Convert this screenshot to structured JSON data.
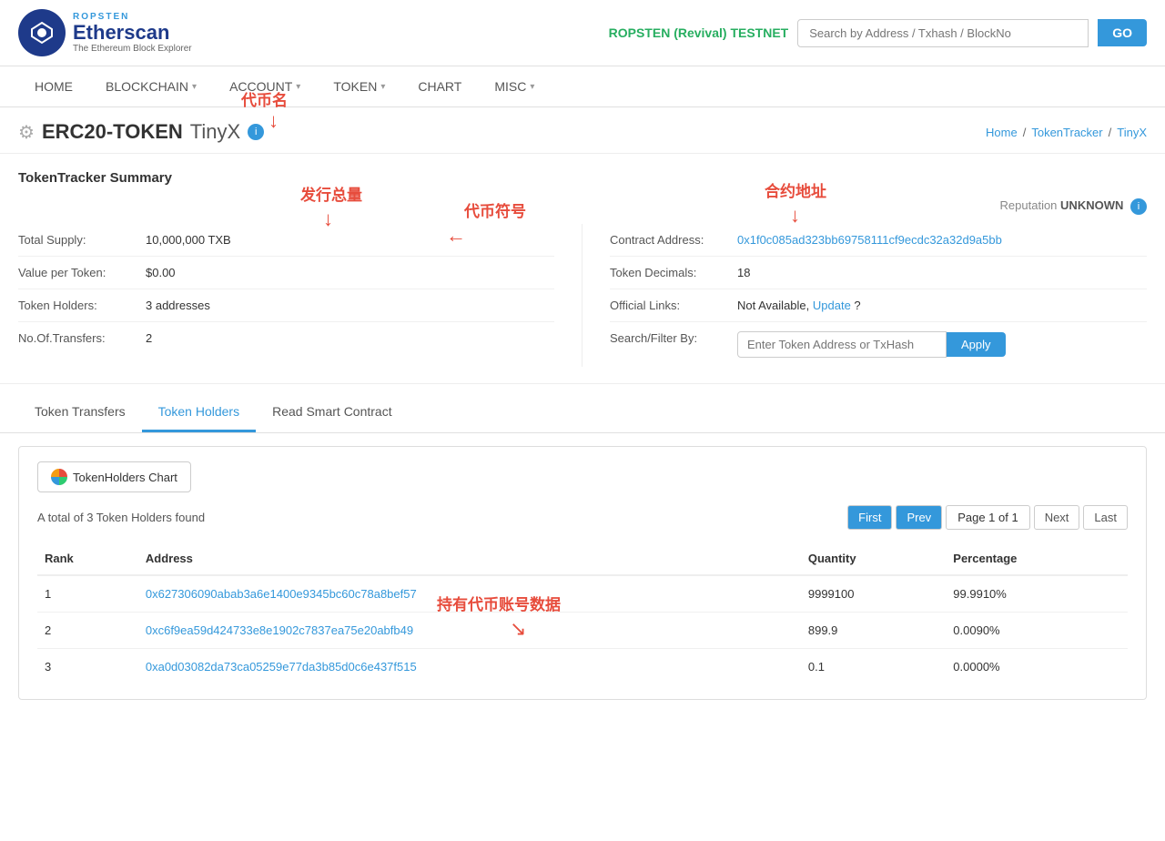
{
  "header": {
    "logo": {
      "ropsten_label": "ROPSTEN",
      "brand": "Etherscan",
      "sub": "The Ethereum Block Explorer"
    },
    "network": "ROPSTEN (Revival) TESTNET",
    "search_placeholder": "Search by Address / Txhash / BlockNo",
    "search_btn": "GO"
  },
  "nav": {
    "items": [
      {
        "label": "HOME",
        "has_caret": false
      },
      {
        "label": "BLOCKCHAIN",
        "has_caret": true
      },
      {
        "label": "ACCOUNT",
        "has_caret": true
      },
      {
        "label": "TOKEN",
        "has_caret": true
      },
      {
        "label": "CHART",
        "has_caret": false
      },
      {
        "label": "MISC",
        "has_caret": true
      }
    ]
  },
  "page": {
    "icon": "⚙",
    "token_standard": "ERC20-TOKEN",
    "token_name": "TinyX",
    "info_icon": "i",
    "breadcrumb": {
      "home": "Home",
      "sep1": "/",
      "tracker": "TokenTracker",
      "sep2": "/",
      "current": "TinyX"
    }
  },
  "summary": {
    "title": "TokenTracker Summary",
    "reputation_label": "Reputation",
    "reputation_value": "UNKNOWN",
    "info_icon": "i",
    "left": [
      {
        "label": "Total Supply:",
        "value": "10,000,000 TXB"
      },
      {
        "label": "Value per Token:",
        "value": "$0.00"
      },
      {
        "label": "Token Holders:",
        "value": "3 addresses"
      },
      {
        "label": "No.Of.Transfers:",
        "value": "2"
      }
    ],
    "right": [
      {
        "label": "Contract Address:",
        "value": "0x1f0c085ad323bb69758111cf9ecdc32a32d9a5bb",
        "is_link": true
      },
      {
        "label": "Token Decimals:",
        "value": "18"
      },
      {
        "label": "Official Links:",
        "value_prefix": "Not Available, ",
        "link_text": "Update",
        "value_suffix": " ?"
      },
      {
        "label": "Search/Filter By:",
        "input_placeholder": "Enter Token Address or TxHash",
        "btn_label": "Apply"
      }
    ]
  },
  "tabs": [
    {
      "label": "Token Transfers",
      "active": false
    },
    {
      "label": "Token Holders",
      "active": true
    },
    {
      "label": "Read Smart Contract",
      "active": false
    }
  ],
  "table_section": {
    "chart_btn": "TokenHolders Chart",
    "total_text": "A total of 3 Token Holders found",
    "pagination": {
      "first": "First",
      "prev": "Prev",
      "page_text": "Page 1 of 1",
      "next": "Next",
      "last": "Last"
    },
    "columns": [
      "Rank",
      "Address",
      "Quantity",
      "Percentage"
    ],
    "rows": [
      {
        "rank": "1",
        "address": "0x627306090abab3a6e1400e9345bc60c78a8bef57",
        "quantity": "9999100",
        "percentage": "99.9910%"
      },
      {
        "rank": "2",
        "address": "0xc6f9ea59d424733e8e1902c7837ea75e20abfb49",
        "quantity": "899.9",
        "percentage": "0.0090%"
      },
      {
        "rank": "3",
        "address": "0xa0d03082da73ca05259e77da3b85d0c6e437f515",
        "quantity": "0.1",
        "percentage": "0.0000%"
      }
    ]
  },
  "annotations": {
    "coin_name_label": "代币名",
    "supply_label": "发行总量",
    "symbol_label": "代币符号",
    "contract_label": "合约地址",
    "holders_label": "持有代币账号数据"
  }
}
